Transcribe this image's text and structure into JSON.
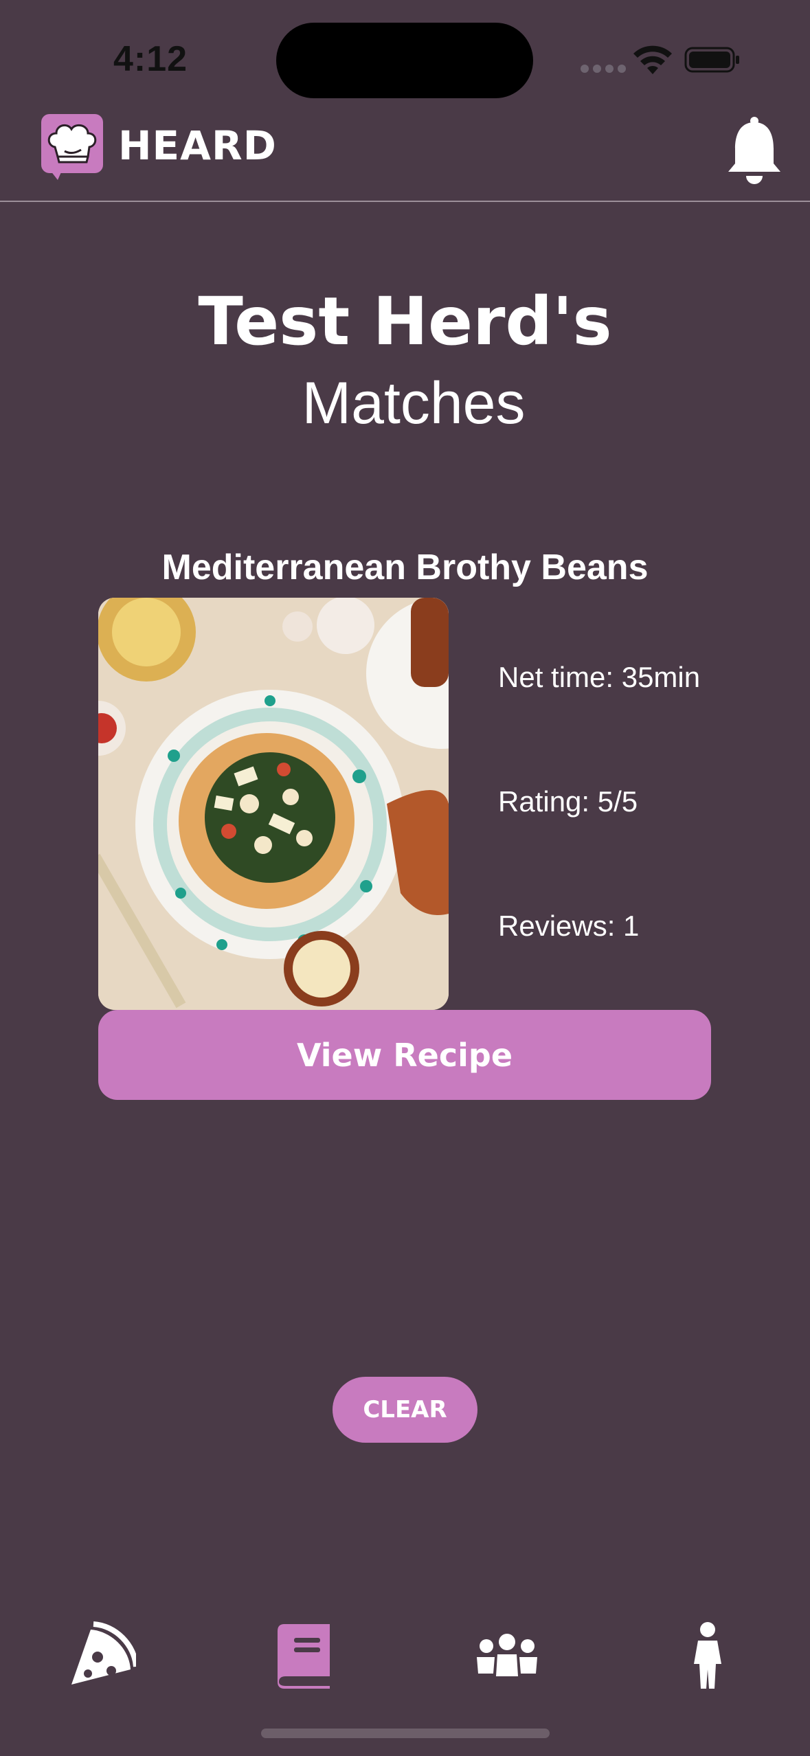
{
  "status_bar": {
    "time": "4:12"
  },
  "header": {
    "app_name": "HEARD",
    "logo_icon": "chef-hat-chat-icon",
    "notification_icon": "bell-icon"
  },
  "headline": {
    "line1": "Test Herd's",
    "line2": "Matches"
  },
  "recipe": {
    "title": "Mediterranean Brothy Beans",
    "net_time": "Net time: 35min",
    "rating": "Rating: 5/5",
    "reviews": "Reviews: 1",
    "view_button": "View Recipe"
  },
  "actions": {
    "clear_button": "CLEAR"
  },
  "tab_bar": {
    "items": [
      {
        "icon": "pizza-slice-icon",
        "active": false
      },
      {
        "icon": "book-icon",
        "active": true
      },
      {
        "icon": "group-icon",
        "active": false
      },
      {
        "icon": "person-icon",
        "active": false
      }
    ]
  },
  "colors": {
    "background": "#4a3a47",
    "accent": "#c87bbf",
    "text": "#ffffff"
  }
}
